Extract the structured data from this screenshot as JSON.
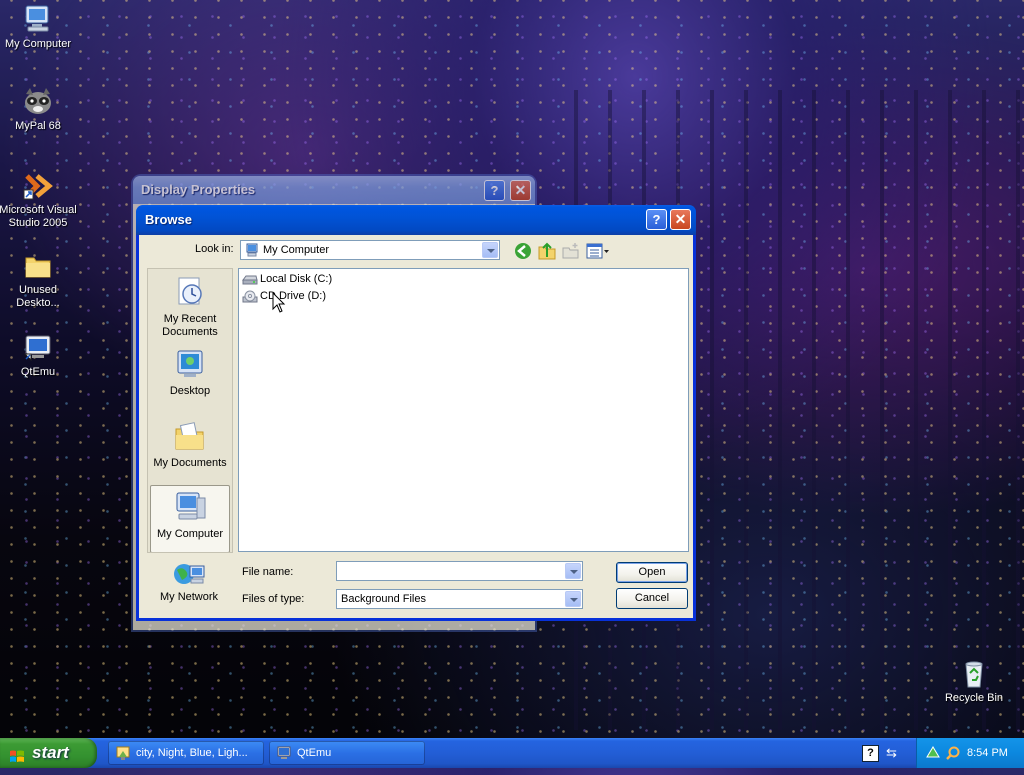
{
  "desktop": {
    "icons": [
      {
        "label": "My Computer"
      },
      {
        "label": "MyPal 68"
      },
      {
        "label": "Microsoft Visual Studio 2005"
      },
      {
        "label": "Unused Deskto..."
      },
      {
        "label": "QtEmu"
      },
      {
        "label": "Recycle Bin"
      }
    ]
  },
  "display_properties": {
    "title": "Display Properties"
  },
  "browse": {
    "title": "Browse",
    "look_in_label": "Look in:",
    "look_in_value": "My Computer",
    "places": [
      {
        "label": "My Recent Documents"
      },
      {
        "label": "Desktop"
      },
      {
        "label": "My Documents"
      },
      {
        "label": "My Computer"
      },
      {
        "label": "My Network"
      }
    ],
    "files": [
      {
        "label": "Local Disk (C:)"
      },
      {
        "label": "CD Drive (D:)"
      }
    ],
    "file_name_label": "File name:",
    "file_name_value": "",
    "files_of_type_label": "Files of type:",
    "files_of_type_value": "Background Files",
    "open_label": "Open",
    "cancel_label": "Cancel"
  },
  "taskbar": {
    "start_label": "start",
    "tasks": [
      {
        "label": "city, Night, Blue, Ligh..."
      },
      {
        "label": "QtEmu"
      }
    ],
    "clock": "8:54 PM"
  },
  "colors": {
    "xp_title_blue": "#0153d6",
    "start_green": "#349230",
    "dialog_face": "#ece9d8"
  }
}
